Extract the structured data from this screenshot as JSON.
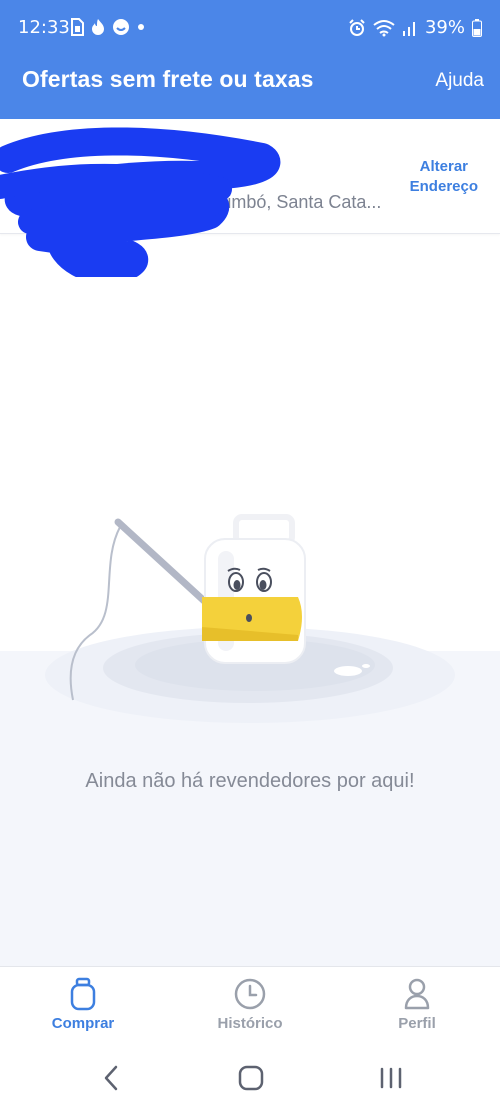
{
  "status_bar": {
    "time": "12:33",
    "battery": "39%",
    "icons": [
      "sim-card-icon",
      "fire-icon",
      "smiley-icon",
      "dot-icon",
      "alarm-icon",
      "wifi-icon",
      "signal-icon",
      "battery-icon"
    ]
  },
  "app_bar": {
    "title": "Ofertas sem frete ou taxas",
    "help": "Ajuda"
  },
  "address": {
    "city": "Timbó, Santa Cata...",
    "change_line1": "Alterar",
    "change_line2": "Endereço"
  },
  "empty_state": {
    "message": "Ainda não há revendedores por aqui!"
  },
  "bottom_nav": {
    "items": [
      {
        "label": "Comprar",
        "icon": "gas-cylinder-icon",
        "active": true
      },
      {
        "label": "Histórico",
        "icon": "clock-icon",
        "active": false
      },
      {
        "label": "Perfil",
        "icon": "person-icon",
        "active": false
      }
    ]
  },
  "colors": {
    "primary": "#4b86e8",
    "accent": "#3d7fe0",
    "muted_text": "#858a96",
    "illustration_yellow": "#f4d13b"
  }
}
